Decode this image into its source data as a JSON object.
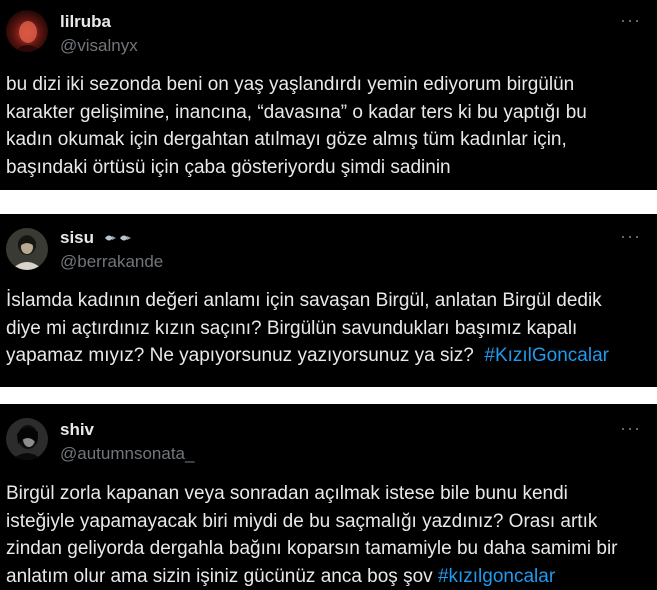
{
  "tweets": [
    {
      "name": "lilruba",
      "handle": "@visalnyx",
      "more_icon": "more-horizontal-icon",
      "lines": [
        "bu dizi iki sezonda beni on yaş yaşlandırdı yemin ediyorum birgülün",
        "karakter gelişimine, inancına, “davasına” o kadar ters ki bu yaptığı bu",
        "kadın okumak için dergahtan atılmayı göze almış tüm kadınlar için,",
        "başındaki örtüsü için çaba gösteriyordu şimdi sadinin"
      ]
    },
    {
      "name": "sisu",
      "name_emoji": "sparkle-emoji-icon",
      "handle": "@berrakande",
      "more_icon": "more-horizontal-icon",
      "lines": [
        "İslamda kadının değeri anlamı için savaşan Birgül, anlatan Birgül dedik",
        "diye mi açtırdınız kızın saçını? Birgülün savundukları başımız kapalı",
        "yapamaz mıyız? Ne yapıyorsunuz yazıyorsunuz ya siz?"
      ],
      "hashtag": "#KızılGoncalar"
    },
    {
      "name": "shiv",
      "handle": "@autumnsonata_",
      "more_icon": "more-horizontal-icon",
      "lines": [
        "Birgül zorla kapanan veya sonradan açılmak istese bile bunu kendi",
        "isteğiyle yapamayacak biri miydi de bu saçmalığı yazdınız? Orası artık",
        "zindan geliyorda dergahla bağını koparsın tamamiyle bu daha samimi bir",
        "anlatım olur ama sizin işiniz gücünüz anca boş şov"
      ],
      "hashtag": "#kızılgoncalar"
    }
  ],
  "colors": {
    "tweet_bg": "#000000",
    "text": "#e7e9ea",
    "muted": "#71767b",
    "link": "#1d9bf0",
    "separator": "#ffffff"
  }
}
